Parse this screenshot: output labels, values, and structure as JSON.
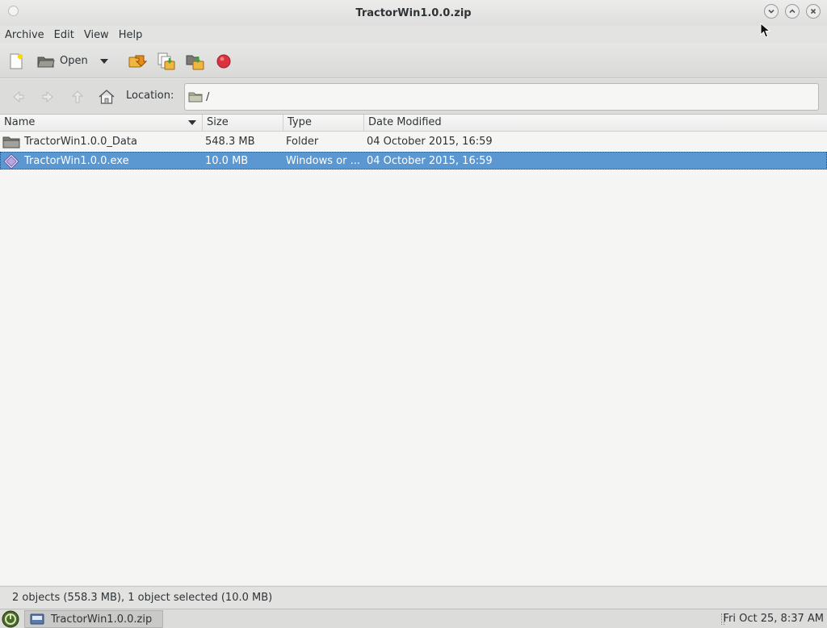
{
  "window": {
    "title": "TractorWin1.0.0.zip"
  },
  "menu": {
    "items": [
      "Archive",
      "Edit",
      "View",
      "Help"
    ]
  },
  "toolbar": {
    "open_label": "Open"
  },
  "location": {
    "label": "Location:",
    "value": "/"
  },
  "list": {
    "columns": [
      "Name",
      "Size",
      "Type",
      "Date Modified"
    ],
    "rows": [
      {
        "name": "TractorWin1.0.0_Data",
        "size": "548.3 MB",
        "type": "Folder",
        "date": "04 October 2015, 16:59"
      },
      {
        "name": "TractorWin1.0.0.exe",
        "size": "10.0 MB",
        "type": "Windows or ...",
        "date": "04 October 2015, 16:59"
      }
    ]
  },
  "status": {
    "text": "2 objects (558.3 MB), 1 object selected (10.0 MB)"
  },
  "taskbar": {
    "task_label": "TractorWin1.0.0.zip",
    "clock": "Fri Oct 25,  8:37 AM"
  },
  "colors": {
    "selection": "#5b97d1",
    "stop": "#d9333f",
    "folder": "#8a8a7a"
  }
}
